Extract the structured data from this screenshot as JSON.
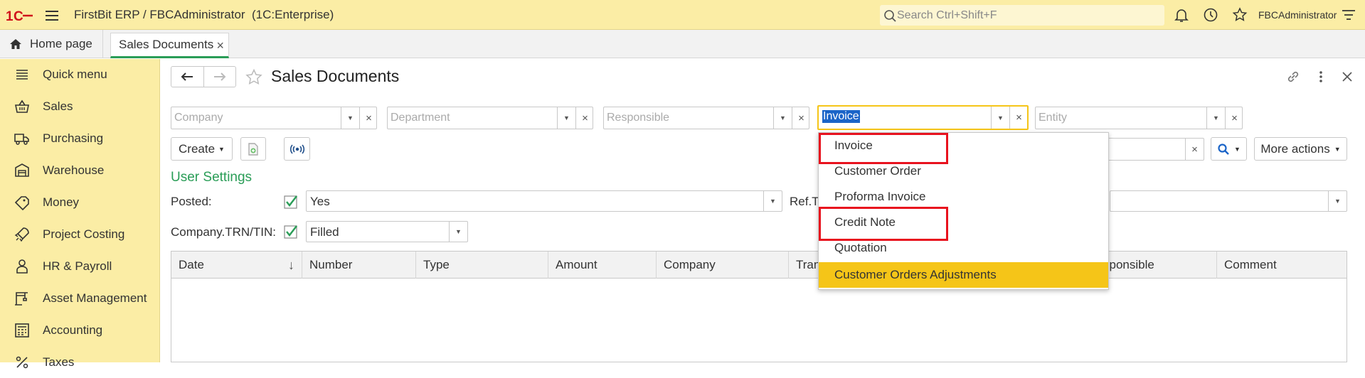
{
  "topbar": {
    "app_title": "FirstBit ERP / FBCAdministrator  (1C:Enterprise)",
    "search_placeholder": "Search Ctrl+Shift+F",
    "username": "FBCAdministrator",
    "bg_color": "#fbeda5"
  },
  "tabs": {
    "home_label": "Home page",
    "active_label": "Sales Documents",
    "close_glyph": "×"
  },
  "sidebar": {
    "items": [
      {
        "label": "Quick menu",
        "icon": "list-icon"
      },
      {
        "label": "Sales",
        "icon": "basket-icon"
      },
      {
        "label": "Purchasing",
        "icon": "truck-icon"
      },
      {
        "label": "Warehouse",
        "icon": "warehouse-icon"
      },
      {
        "label": "Money",
        "icon": "money-icon"
      },
      {
        "label": "Project Costing",
        "icon": "rocket-icon"
      },
      {
        "label": "HR & Payroll",
        "icon": "person-icon"
      },
      {
        "label": "Asset Management",
        "icon": "crane-icon"
      },
      {
        "label": "Accounting",
        "icon": "calculator-icon"
      },
      {
        "label": "Taxes",
        "icon": "percent-icon"
      }
    ]
  },
  "page": {
    "title": "Sales Documents"
  },
  "filters": {
    "company_placeholder": "Company",
    "department_placeholder": "Department",
    "responsible_placeholder": "Responsible",
    "type_value": "Invoice",
    "entity_placeholder": "Entity",
    "clear_glyph": "×"
  },
  "toolbar": {
    "create_label": "Create",
    "more_actions_label": "More actions"
  },
  "user_settings": {
    "title": "User Settings",
    "posted_label": "Posted:",
    "posted_value": "Yes",
    "posted_checked": true,
    "ref_label": "Ref.T",
    "trn_label": "Company.TRN/TIN:",
    "trn_value": "Filled",
    "trn_checked": true
  },
  "table": {
    "columns": [
      "Date",
      "Number",
      "Type",
      "Amount",
      "Company",
      "Tran",
      "sponsible",
      "Comment"
    ],
    "sort_glyph": "↓"
  },
  "dropdown": {
    "items": [
      "Invoice",
      "Customer Order",
      "Proforma Invoice",
      "Credit Note",
      "Quotation",
      "Customer Orders Adjustments"
    ],
    "selected_index": 5,
    "highlighted": [
      "Invoice",
      "Credit Note"
    ],
    "highlight_color": "#e8121e",
    "selected_color": "#f5c518"
  },
  "colors": {
    "accent_green": "#2a9d57",
    "selection_blue": "#1a64c8"
  }
}
